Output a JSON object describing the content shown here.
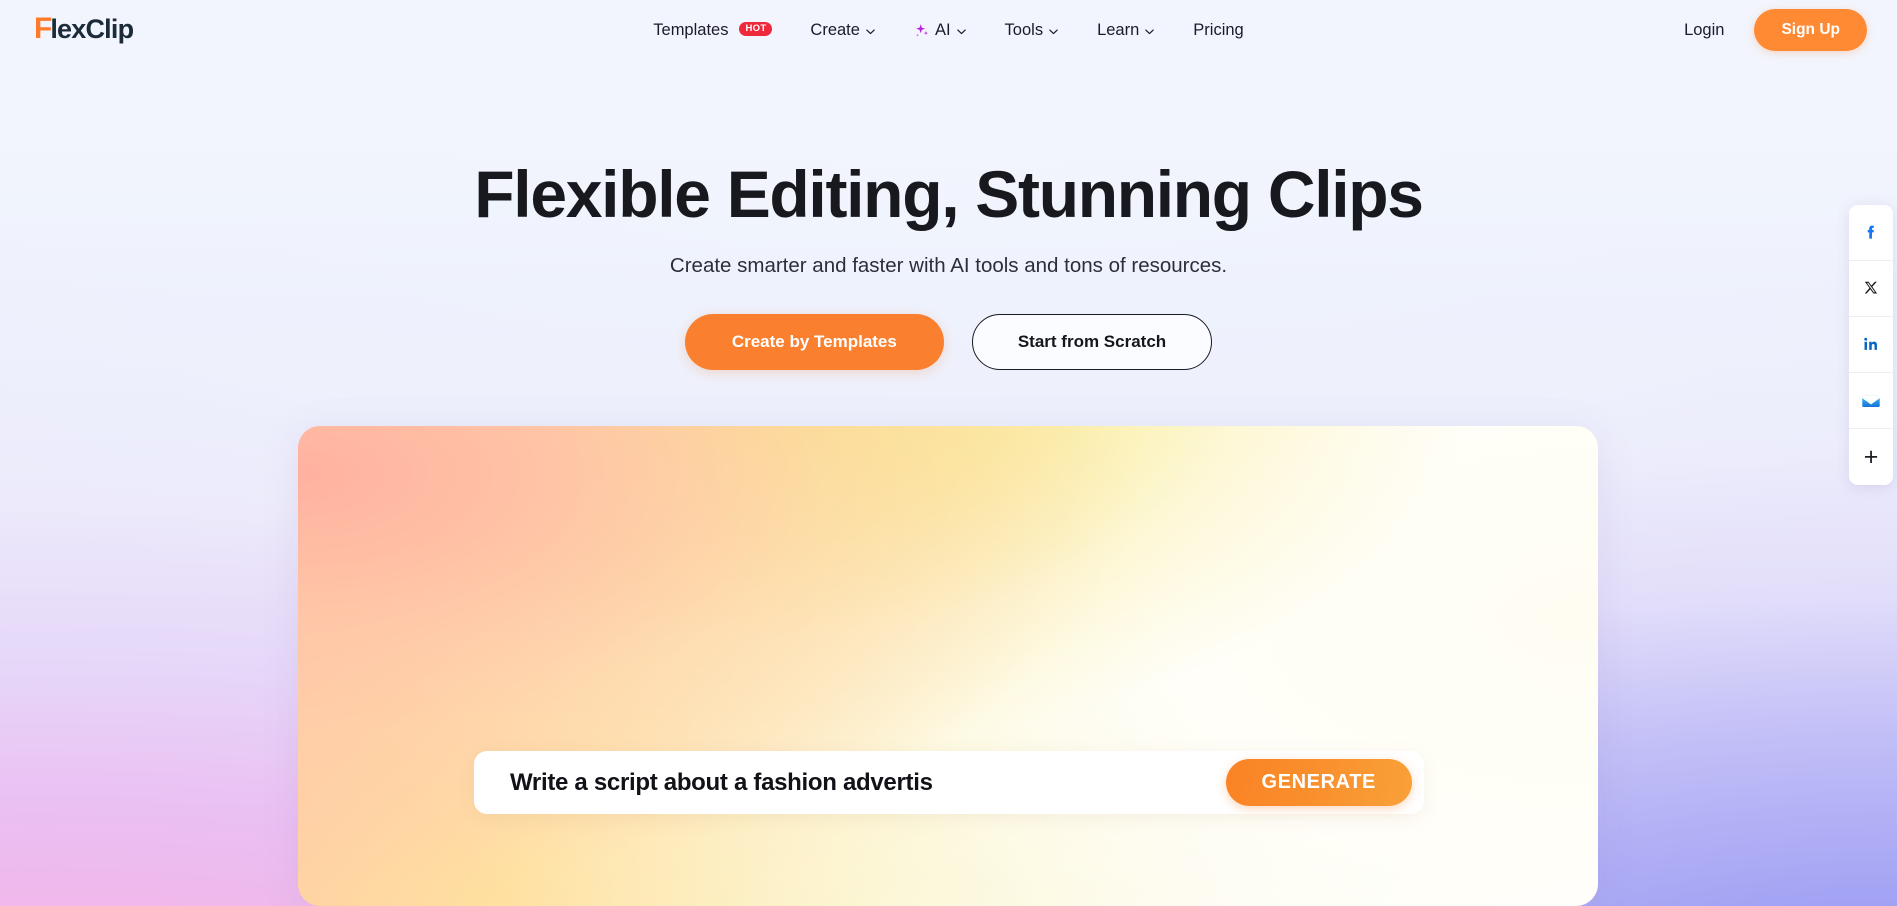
{
  "header": {
    "logo": {
      "mark": "F",
      "word": "lexClip"
    },
    "nav": [
      {
        "label": "Templates",
        "badge": "HOT",
        "has_caret": false,
        "icon": null
      },
      {
        "label": "Create",
        "badge": null,
        "has_caret": true,
        "icon": null
      },
      {
        "label": "AI",
        "badge": null,
        "has_caret": true,
        "icon": "sparkle-icon"
      },
      {
        "label": "Tools",
        "badge": null,
        "has_caret": true,
        "icon": null
      },
      {
        "label": "Learn",
        "badge": null,
        "has_caret": true,
        "icon": null
      },
      {
        "label": "Pricing",
        "badge": null,
        "has_caret": false,
        "icon": null
      }
    ],
    "login_label": "Login",
    "signup_label": "Sign Up"
  },
  "hero": {
    "title": "Flexible Editing, Stunning Clips",
    "subtitle": "Create smarter and faster with AI tools and tons of resources.",
    "primary_cta": "Create by Templates",
    "secondary_cta": "Start from Scratch"
  },
  "preview": {
    "prompt_text": "Write a script about a fashion advertis",
    "generate_label": "GENERATE"
  },
  "social_rail": [
    {
      "name": "facebook-icon",
      "title": "Facebook"
    },
    {
      "name": "x-twitter-icon",
      "title": "X"
    },
    {
      "name": "linkedin-icon",
      "title": "LinkedIn"
    },
    {
      "name": "email-icon",
      "title": "Email"
    },
    {
      "name": "more-share-icon",
      "title": "+"
    }
  ],
  "colors": {
    "brand_orange": "#ff8a33",
    "cta_orange": "#fa8030",
    "hot_red": "#f0283c",
    "logo_dark": "#1c2b3a",
    "ai_purple": "#b722e0",
    "page_bg": "#f2f5fd",
    "facebook_blue": "#1877f2",
    "linkedin_blue": "#0a66c2",
    "email_blue": "#1a8ae5"
  }
}
